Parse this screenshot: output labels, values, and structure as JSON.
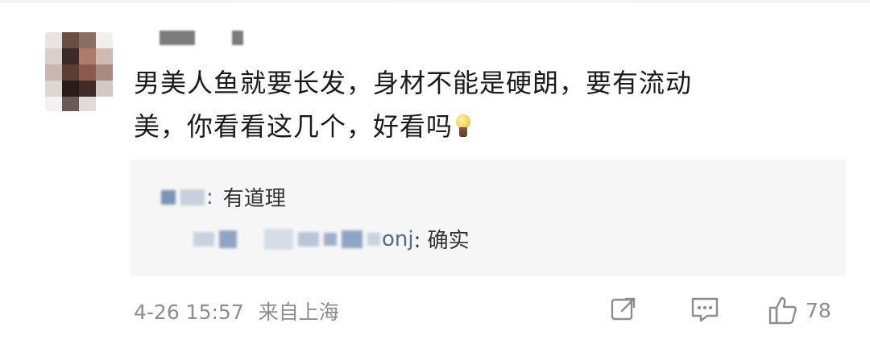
{
  "comment": {
    "text_line1": "男美人鱼就要长发，身材不能是硬朗，要有流动",
    "text_line2": "美，你看看这几个，好看吗",
    "emoji_icon": "light-bulb-icon"
  },
  "replies": [
    {
      "name_visible": ":",
      "text": "有道理"
    },
    {
      "name_visible": "onj",
      "text": "确实"
    }
  ],
  "footer": {
    "date": "4-26 15:57",
    "location": "来自上海",
    "share_icon": "share-icon",
    "comment_icon": "comment-icon",
    "like_icon": "thumbs-up-icon",
    "like_count": "78"
  },
  "colors": {
    "text": "#1a1a1a",
    "meta": "#8d8d8d",
    "reply_bg": "#f6f6f6",
    "reply_text": "#333333"
  }
}
